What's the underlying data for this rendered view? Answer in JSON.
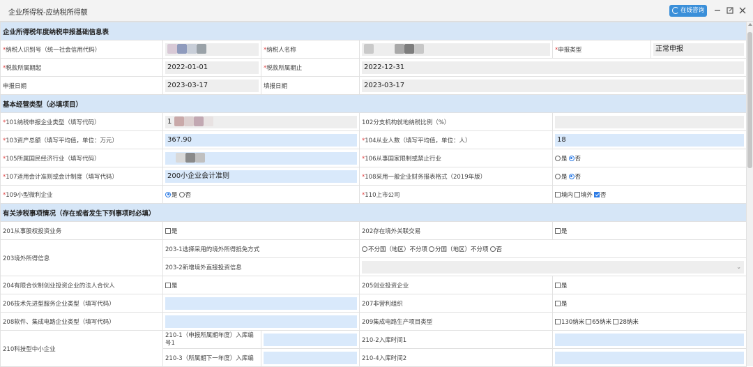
{
  "window": {
    "title": "企业所得税-应纳税所得额",
    "consult_label": "在线咨询"
  },
  "basic": {
    "section_title": "企业所得税年度纳税申报基础信息表",
    "taxpayer_id_label": "纳税人识别号（统一社会信用代码）",
    "taxpayer_name_label": "纳税人名称",
    "declare_type_label": "申报类型",
    "declare_type_value": "正常申报",
    "period_start_label": "税款所属期起",
    "period_start_value": "2022-01-01",
    "period_end_label": "税款所属期止",
    "period_end_value": "2022-12-31",
    "declare_date_label": "申报日期",
    "declare_date_value": "2023-03-17",
    "fill_date_label": "填报日期",
    "fill_date_value": "2023-03-17"
  },
  "business": {
    "section_title": "基本经营类型（必填项目）",
    "r101_label": "101纳税申报企业类型（填写代码）",
    "r101_value": "1",
    "r102_label": "102分支机构就地纳税比例（%）",
    "r103_label": "103资产总额（填写平均值，单位：万元）",
    "r103_value": "367.90",
    "r104_label": "104从业人数（填写平均值，单位：人）",
    "r104_value": "18",
    "r105_label": "105所属国民经济行业（填写代码）",
    "r106_label": "106从事国家限制或禁止行业",
    "r107_label": "107适用会计准则或会计制度（填写代码）",
    "r107_value": "200小企业会计准则",
    "r108_label": "108采用一般企业财务报表格式（2019年版）",
    "r109_label": "109小型微利企业",
    "r110_label": "110上市公司",
    "opt_yes": "是",
    "opt_no": "否",
    "opt_domestic": "境内",
    "opt_overseas": "境外"
  },
  "tax_items": {
    "section_title": "有关涉税事项情况（存在或者发生下列事项时必填）",
    "r201_label": "201从事股权投资业务",
    "r202_label": "202存在境外关联交易",
    "r203_label": "203境外所得信息",
    "r203_1_label": "203-1选择采用的境外所得抵免方式",
    "r203_1_opt1": "不分国（地区）不分项",
    "r203_1_opt2": "分国（地区）不分项",
    "r203_1_opt3": "否",
    "r203_2_label": "203-2新增境外直接投资信息",
    "r204_label": "204有限合伙制创业投资企业的法人合伙人",
    "r205_label": "205创业投资企业",
    "r206_label": "206技术先进型服务企业类型（填写代码）",
    "r207_label": "207非营利组织",
    "r208_label": "208软件、集成电路企业类型（填写代码）",
    "r209_label": "209集成电路生产项目类型",
    "r209_opt1": "130纳米",
    "r209_opt2": "65纳米",
    "r209_opt3": "28纳米",
    "r210_label": "210科技型中小企业",
    "r210_1_label_a": "210-1（申报所属期年度）入库编",
    "r210_1_label_b": "号1",
    "r210_2_label": "210-2入库时间1",
    "r210_3_label": "210-3（所属期下一年度）入库编",
    "r210_4_label": "210-4入库时间2",
    "opt_yes": "是"
  }
}
